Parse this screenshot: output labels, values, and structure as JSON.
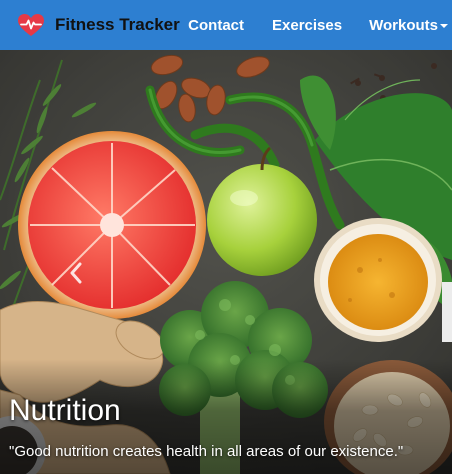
{
  "navbar": {
    "brand": "Fitness Tracker",
    "brand_icon": "heart-pulse-icon",
    "links": {
      "contact": "Contact",
      "exercises": "Exercises",
      "workouts": "Workouts"
    },
    "background_color": "#2d7fd1"
  },
  "carousel": {
    "slide": {
      "title": "Nutrition",
      "quote": "\"Good nutrition creates health in all areas of our existence.\""
    }
  }
}
